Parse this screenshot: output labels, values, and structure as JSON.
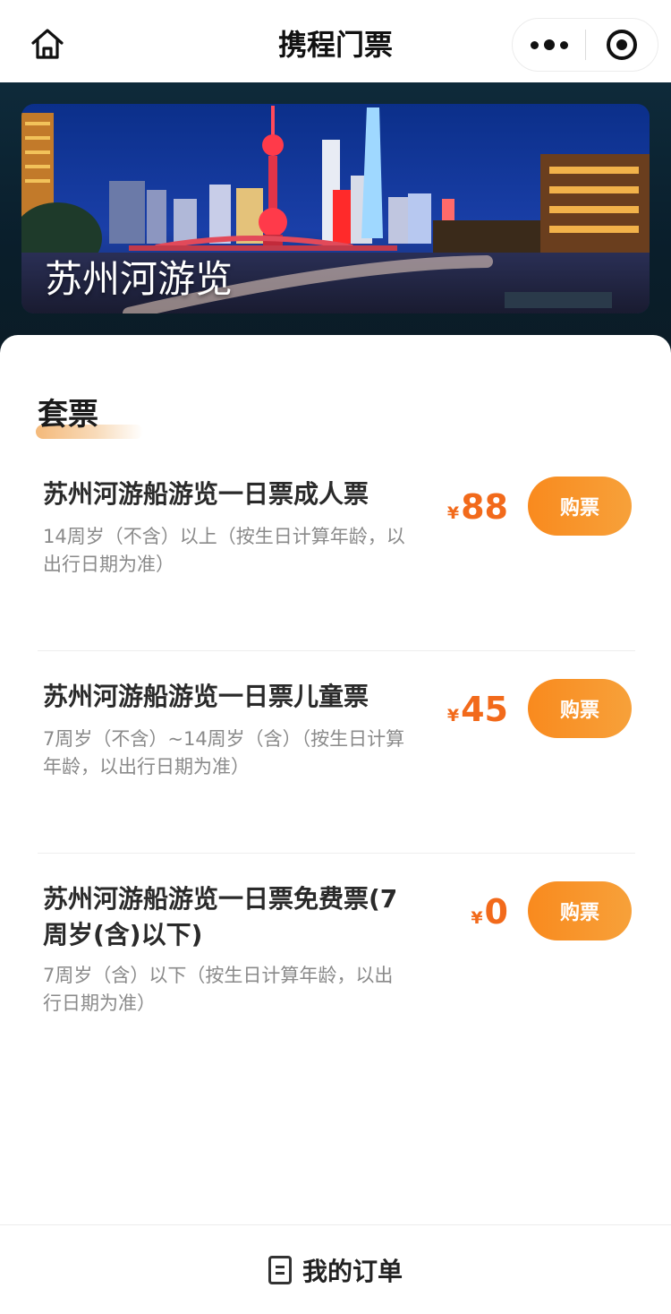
{
  "nav": {
    "title": "携程门票",
    "icons": {
      "home": "home-icon",
      "more": "more-dots-icon",
      "close": "target-close-icon"
    }
  },
  "banner": {
    "title": "苏州河游览"
  },
  "section": {
    "title": "套票"
  },
  "tickets": [
    {
      "name": "苏州河游船游览一日票成人票",
      "desc": "14周岁（不含）以上（按生日计算年龄，以出行日期为准）",
      "currency": "¥",
      "price": "88",
      "buy_label": "购票"
    },
    {
      "name": "苏州河游船游览一日票儿童票",
      "desc": "7周岁（不含）~14周岁（含）（按生日计算年龄，以出行日期为准）",
      "currency": "¥",
      "price": "45",
      "buy_label": "购票"
    },
    {
      "name": "苏州河游船游览一日票免费票(7周岁(含)以下)",
      "desc": "7周岁（含）以下（按生日计算年龄，以出行日期为准）",
      "currency": "¥",
      "price": "0",
      "buy_label": "购票"
    }
  ],
  "bottom": {
    "orders_label": "我的订单",
    "icon": "order-list-icon"
  },
  "colors": {
    "accent": "#f26a1b",
    "button": "#f98a1e",
    "hero_bg": "#0e2a3a"
  }
}
